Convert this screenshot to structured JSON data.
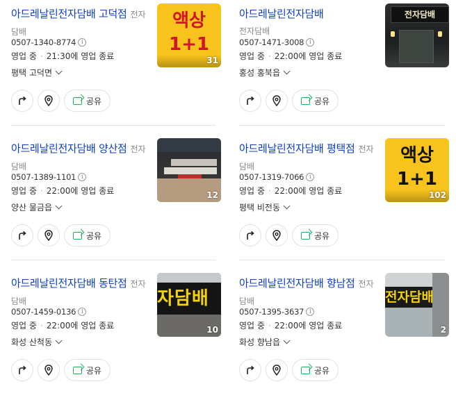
{
  "category": "전자담배",
  "share_label": "공유",
  "status_label": "영업 중",
  "colors": {
    "title": "#0b3ec0",
    "share_icon": "#1fb45f",
    "promo_bg": "#f7c31c",
    "promo_text": "#d0152b"
  },
  "places": [
    {
      "name": "아드레날린전자담배 고덕점",
      "phone": "0507-1340-8774",
      "hours": "21:30에 영업 종료",
      "address": "평택 고덕면",
      "photo_count": "31",
      "thumb": "promo",
      "promo_line1": "액상",
      "promo_line2": "1+1"
    },
    {
      "name": "아드레날린전자담배",
      "phone": "0507-1471-3008",
      "hours": "22:00에 영업 종료",
      "address": "홍성 홍북읍",
      "photo_count": "",
      "thumb": "night",
      "sign_text": "전자담배"
    },
    {
      "name": "아드레날린전자담배 양산점",
      "phone": "0507-1389-1101",
      "hours": "22:00에 영업 종료",
      "address": "양산 물금읍",
      "photo_count": "12",
      "thumb": "store"
    },
    {
      "name": "아드레날린전자담배 평택점",
      "phone": "0507-1319-7066",
      "hours": "22:00에 영업 종료",
      "address": "평택 비전동",
      "photo_count": "102",
      "thumb": "promo2",
      "promo_line1": "액상",
      "promo_line2": "1+1"
    },
    {
      "name": "아드레날린전자담배 동탄점",
      "phone": "0507-1459-0136",
      "hours": "22:00에 영업 종료",
      "address": "화성 산척동",
      "photo_count": "10",
      "thumb": "sign",
      "sign_text": "자담배"
    },
    {
      "name": "아드레날린전자담배 향남점",
      "phone": "0507-1395-3637",
      "hours": "22:00에 영업 종료",
      "address": "화성 향남읍",
      "photo_count": "2",
      "thumb": "street",
      "sign_text": "전자담배"
    }
  ],
  "icons": {
    "directions": "directions-icon",
    "location": "location-pin-icon",
    "share": "share-icon",
    "info": "info-icon",
    "expand": "chevron-down-icon"
  }
}
